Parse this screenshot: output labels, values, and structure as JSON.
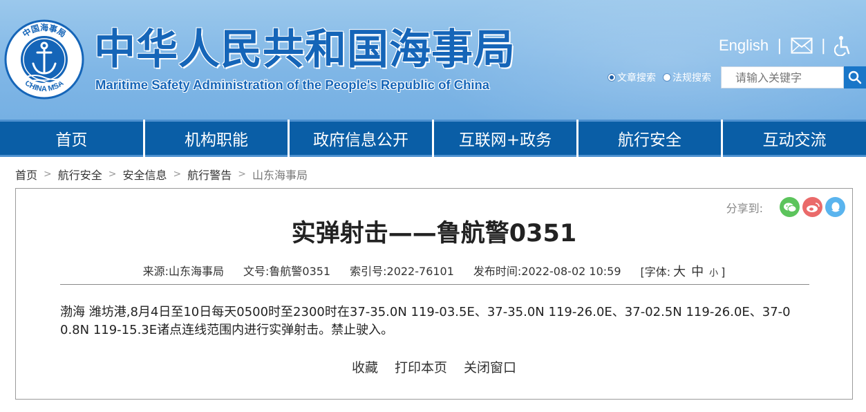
{
  "header": {
    "emblem_ring_top": "中国海事局",
    "emblem_ring_bottom": "CHINA MSA",
    "site_title": "中华人民共和国海事局",
    "site_subtitle": "Maritime Safety Administration of the People's Republic of China",
    "lang_link": "English",
    "separator": "|",
    "icons": [
      "mail-icon",
      "accessibility-icon"
    ],
    "search": {
      "option_article": "文章搜索",
      "option_law": "法规搜索",
      "selected": "文章搜索",
      "placeholder": "请输入关键字"
    }
  },
  "nav": {
    "items": [
      "首页",
      "机构职能",
      "政府信息公开",
      "互联网+政务",
      "航行安全",
      "互动交流"
    ]
  },
  "breadcrumb": {
    "items": [
      "首页",
      "航行安全",
      "安全信息",
      "航行警告",
      "山东海事局"
    ],
    "sep": ">"
  },
  "article": {
    "share_label": "分享到:",
    "share_icons": [
      "wechat-icon",
      "weibo-icon",
      "qq-icon"
    ],
    "title": "实弹射击——鲁航警0351",
    "meta": {
      "source": "来源:山东海事局",
      "doc_no": "文号:鲁航警0351",
      "index_no": "索引号:2022-76101",
      "publish_time": "发布时间:2022-08-02 10:59",
      "font_label": "[字体:",
      "font_large": "大",
      "font_medium": "中",
      "font_small": "小",
      "font_close": "]"
    },
    "body": "渤海 潍坊港,8月4日至10日每天0500时至2300时在37-35.0N 119-03.5E、37-35.0N 119-26.0E、37-02.5N 119-26.0E、37-00.8N 119-15.3E诸点连线范围内进行实弹射击。禁止驶入。",
    "actions": {
      "favorite": "收藏",
      "print": "打印本页",
      "close": "关闭窗口"
    }
  },
  "colors": {
    "nav_bg": "#0a5ea6",
    "nav_border": "#4d90cf",
    "header_bg": "#7fb6e6",
    "title_blue": "#1565b8"
  }
}
